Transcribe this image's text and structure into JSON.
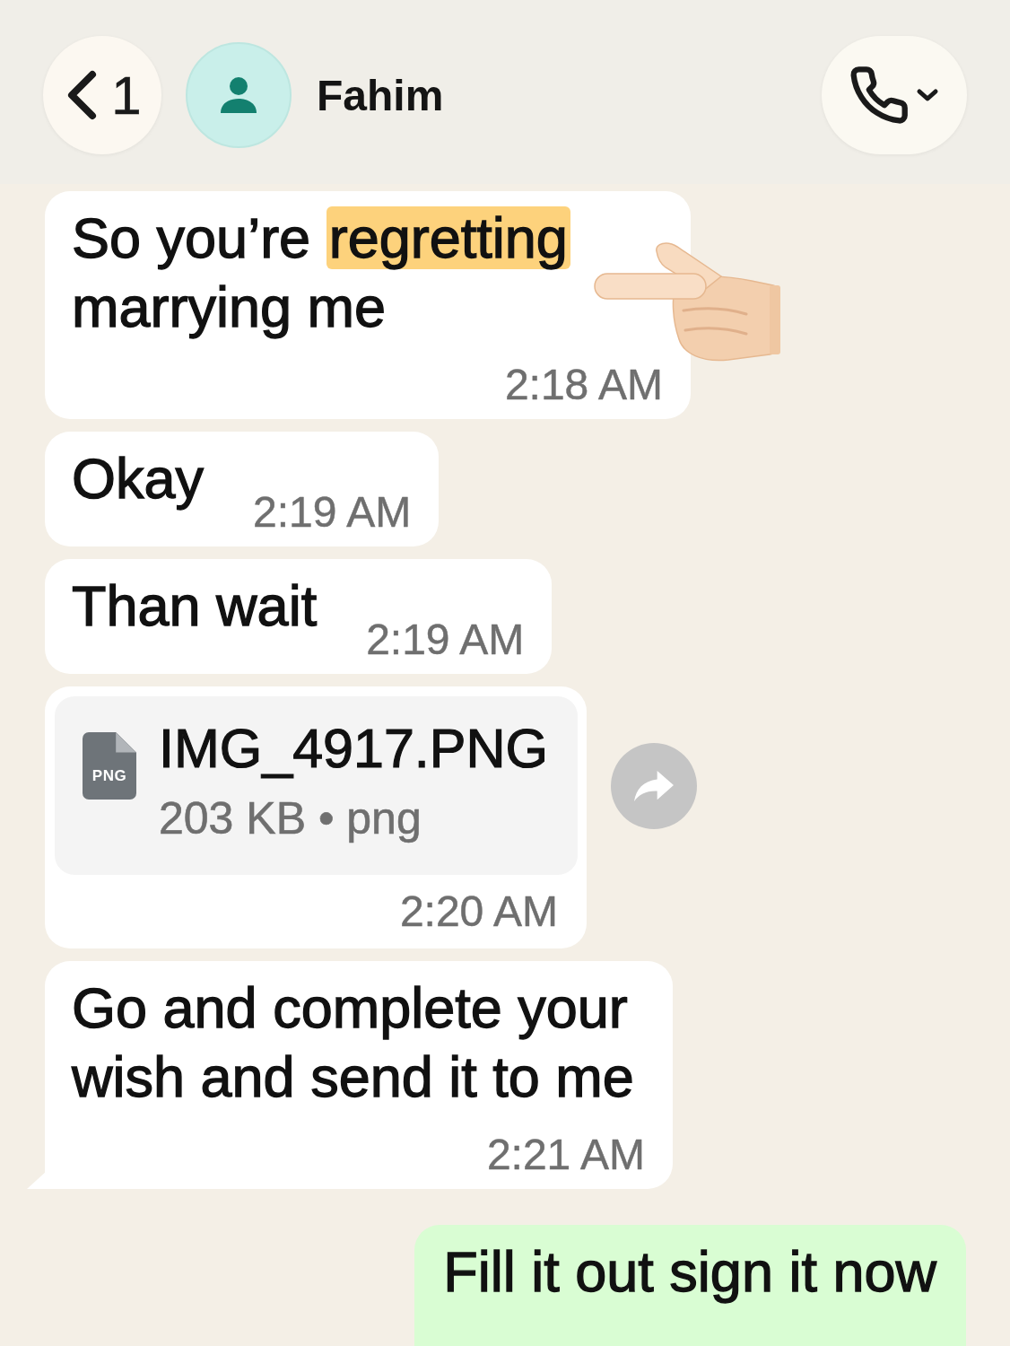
{
  "header": {
    "back_count": "1",
    "contact_name": "Fahim"
  },
  "messages": [
    {
      "kind": "text",
      "outgoing": false,
      "tail": false,
      "forward_button": false,
      "parts": [
        {
          "text": "So you’re ",
          "highlighted": false
        },
        {
          "text": "regretting",
          "highlighted": true
        },
        {
          "text": " marrying me",
          "highlighted": false
        }
      ],
      "time": "2:18 AM"
    },
    {
      "kind": "text",
      "outgoing": false,
      "tail": false,
      "forward_button": false,
      "parts": [
        {
          "text": "Okay",
          "highlighted": false
        }
      ],
      "time": "2:19 AM"
    },
    {
      "kind": "text",
      "outgoing": false,
      "tail": false,
      "forward_button": false,
      "parts": [
        {
          "text": "Than wait",
          "highlighted": false
        }
      ],
      "time": "2:19 AM"
    },
    {
      "kind": "file",
      "outgoing": false,
      "tail": false,
      "forward_button": true,
      "file": {
        "badge": "PNG",
        "name": "IMG_4917.PNG",
        "details": "203 KB • png"
      },
      "time": "2:20 AM"
    },
    {
      "kind": "text",
      "outgoing": false,
      "tail": true,
      "forward_button": false,
      "parts": [
        {
          "text": "Go and complete your wish and send it to me",
          "highlighted": false
        }
      ],
      "time": "2:21 AM"
    },
    {
      "kind": "text",
      "outgoing": true,
      "tail": false,
      "forward_button": false,
      "parts": [
        {
          "text": "Fill it out sign it now",
          "highlighted": false
        }
      ]
    }
  ]
}
